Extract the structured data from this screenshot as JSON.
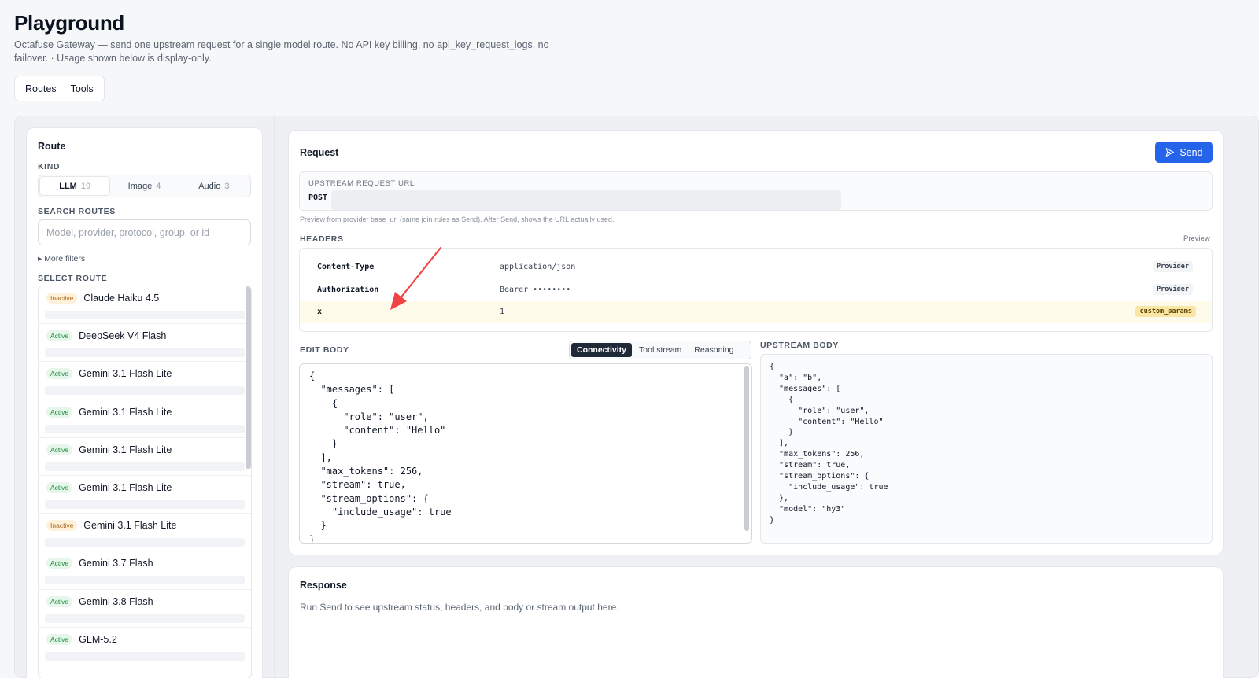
{
  "header": {
    "title": "Playground",
    "subtitle": "Octafuse Gateway — send one upstream request for a single model route. No API key billing, no api_key_request_logs, no failover. · Usage shown below is display-only."
  },
  "top_tabs": [
    "Routes",
    "Tools"
  ],
  "route_panel": {
    "title": "Route",
    "kind_label": "KIND",
    "kinds": [
      {
        "label": "LLM",
        "count": "19"
      },
      {
        "label": "Image",
        "count": "4"
      },
      {
        "label": "Audio",
        "count": "3"
      }
    ],
    "search_label": "SEARCH ROUTES",
    "search_placeholder": "Model, provider, protocol, group, or id",
    "more_filters": "▸ More filters",
    "select_label": "SELECT ROUTE",
    "routes": [
      {
        "status": "Inactive",
        "name": "Claude Haiku 4.5"
      },
      {
        "status": "Active",
        "name": "DeepSeek V4 Flash"
      },
      {
        "status": "Active",
        "name": "Gemini 3.1 Flash Lite"
      },
      {
        "status": "Active",
        "name": "Gemini 3.1 Flash Lite"
      },
      {
        "status": "Active",
        "name": "Gemini 3.1 Flash Lite"
      },
      {
        "status": "Active",
        "name": "Gemini 3.1 Flash Lite"
      },
      {
        "status": "Inactive",
        "name": "Gemini 3.1 Flash Lite"
      },
      {
        "status": "Active",
        "name": "Gemini 3.7 Flash"
      },
      {
        "status": "Active",
        "name": "Gemini 3.8 Flash"
      },
      {
        "status": "Active",
        "name": "GLM-5.2"
      }
    ]
  },
  "request": {
    "title": "Request",
    "send_label": "Send",
    "url_label": "UPSTREAM REQUEST URL",
    "method": "POST",
    "url_hint": "Preview from provider base_url (same join rules as Send). After Send, shows the URL actually used.",
    "headers_label": "HEADERS",
    "preview_label": "Preview",
    "headers": [
      {
        "key": "Content-Type",
        "value": "application/json",
        "source": "Provider"
      },
      {
        "key": "Authorization",
        "value": "Bearer ••••••••",
        "source": "Provider"
      },
      {
        "key": "x",
        "value": "1",
        "source": "custom_params"
      }
    ],
    "edit_body_label": "EDIT BODY",
    "body_tabs": [
      "Connectivity",
      "Tool stream",
      "Reasoning"
    ],
    "edit_body": "{\n  \"messages\": [\n    {\n      \"role\": \"user\",\n      \"content\": \"Hello\"\n    }\n  ],\n  \"max_tokens\": 256,\n  \"stream\": true,\n  \"stream_options\": {\n    \"include_usage\": true\n  }\n}",
    "upstream_body_label": "UPSTREAM BODY",
    "upstream_body": "{\n  \"a\": \"b\",\n  \"messages\": [\n    {\n      \"role\": \"user\",\n      \"content\": \"Hello\"\n    }\n  ],\n  \"max_tokens\": 256,\n  \"stream\": true,\n  \"stream_options\": {\n    \"include_usage\": true\n  },\n  \"model\": \"hy3\"\n}"
  },
  "response": {
    "title": "Response",
    "placeholder": "Run Send to see upstream status, headers, and body or stream output here."
  },
  "colors": {
    "accent": "#2563eb",
    "active_badge": "#1f8a3e",
    "inactive_badge": "#a8681a",
    "annotation_arrow": "#ef4444"
  },
  "icons": [
    "send-icon",
    "triangle-right-icon",
    "annotation-arrow"
  ]
}
